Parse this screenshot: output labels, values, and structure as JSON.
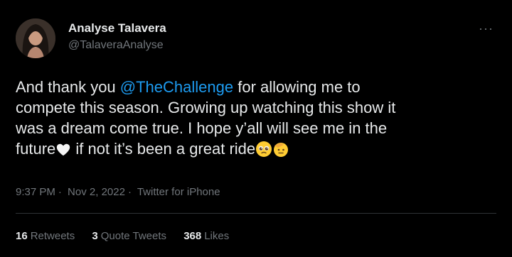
{
  "author": {
    "display_name": "Analyse Talavera",
    "handle": "@TalaveraAnalyse"
  },
  "more_icon": "more-dots-icon",
  "tweet": {
    "line1_before": "And thank you ",
    "mention": "@TheChallenge",
    "line1_after": " for allowing me to",
    "line2": "compete this season. Growing up watching this show it",
    "line3": "was a dream come true. I hope y’all will see me in the",
    "line4_before": "future",
    "line4_after": " if not it’s been a great ride",
    "emojis": [
      "white-heart-icon",
      "pleading-face-icon",
      "saluting-face-icon"
    ]
  },
  "meta": {
    "time": "9:37 PM",
    "date": "Nov 2, 2022",
    "source": "Twitter for iPhone"
  },
  "stats": {
    "retweets_count": "16",
    "retweets_label": "Retweets",
    "quotes_count": "3",
    "quotes_label": "Quote Tweets",
    "likes_count": "368",
    "likes_label": "Likes"
  },
  "colors": {
    "background": "#000000",
    "text": "#e7e9ea",
    "secondary": "#71767b",
    "link": "#1d9bf0"
  }
}
